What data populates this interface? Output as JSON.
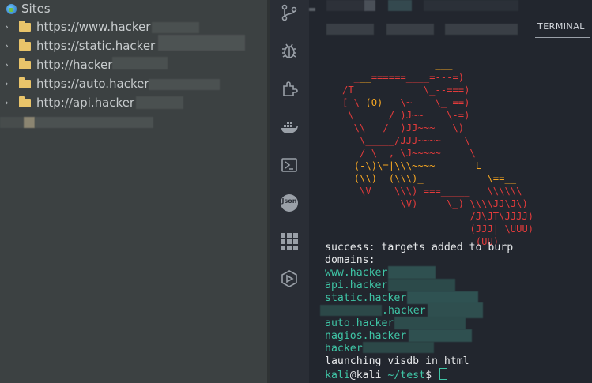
{
  "explorer": {
    "root_label": "Sites",
    "items": [
      {
        "label": "https://www.hacker"
      },
      {
        "label": "https://static.hacker"
      },
      {
        "label": "http://hacker"
      },
      {
        "label": "https://auto.hacker"
      },
      {
        "label": "http://api.hacker"
      }
    ]
  },
  "activity_bar": {
    "icons": [
      "source-control-icon",
      "debug-icon",
      "extensions-icon",
      "docker-icon",
      "powershell-icon",
      "json-icon",
      "grid-icon",
      "run-icon"
    ],
    "json_label": "Json"
  },
  "terminal": {
    "tab_label": "TERMINAL",
    "success_line": "success: targets added to burp",
    "domains_label": "domains:",
    "domains": [
      "www.hacker",
      "api.hacker",
      "static.hacker",
      ".hacker",
      "auto.hacker",
      "nagios.hacker",
      "hacker"
    ],
    "launch_line": "launching visdb in html",
    "prompt_user": "kali",
    "prompt_host": "@kali",
    "prompt_path": "~/test",
    "prompt_symbol": "$"
  },
  "colors": {
    "terminal_bg": "#22262e",
    "ascii_red": "#e23b3b",
    "ascii_orange": "#f5a623",
    "prompt_green": "#3fc5a6"
  }
}
